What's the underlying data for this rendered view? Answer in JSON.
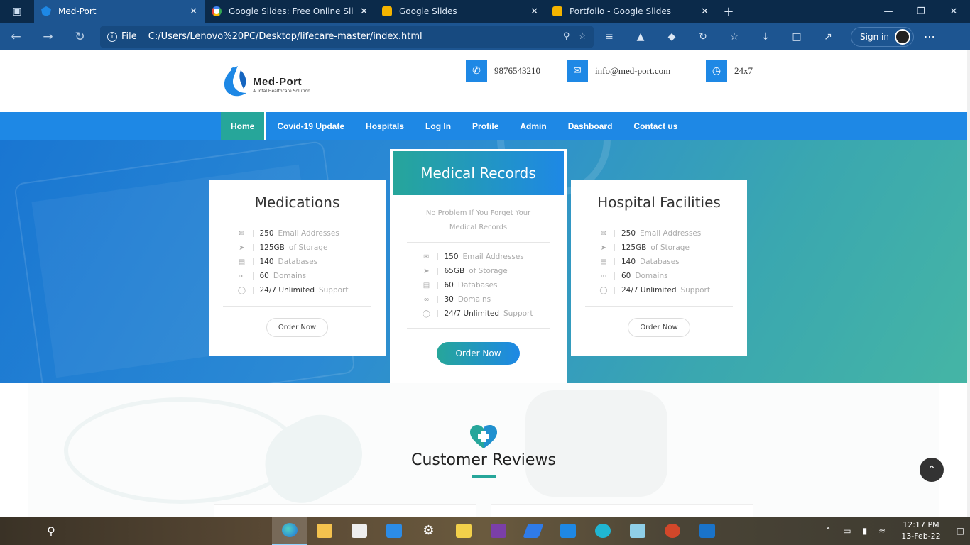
{
  "browser": {
    "tabs": [
      {
        "title": "Med-Port",
        "favicon": "med-port-favicon",
        "active": true
      },
      {
        "title": "Google Slides: Free Online Slide",
        "favicon": "google-favicon",
        "active": false
      },
      {
        "title": "Google Slides",
        "favicon": "slides-favicon",
        "active": false
      },
      {
        "title": "Portfolio - Google Slides",
        "favicon": "slides-favicon",
        "active": false
      }
    ],
    "address_scheme": "File",
    "address_url": "C:/Users/Lenovo%20PC/Desktop/lifecare-master/index.html",
    "sign_in": "Sign in"
  },
  "site": {
    "logo_name": "Med-Port",
    "logo_tagline": "A Total Healthcare Solution",
    "phone": "9876543210",
    "email": "info@med-port.com",
    "hours": "24x7",
    "accent": "#1e88e5",
    "accent2": "#26a69a"
  },
  "menu": [
    "Home",
    "Covid-19 Update",
    "Hospitals",
    "Log In",
    "Profile",
    "Admin",
    "Dashboard",
    "Contact us"
  ],
  "cards": {
    "left": {
      "title": "Medications",
      "features": [
        {
          "num": "250",
          "text": "Email Addresses"
        },
        {
          "num": "125GB",
          "text": "of Storage"
        },
        {
          "num": "140",
          "text": "Databases"
        },
        {
          "num": "60",
          "text": "Domains"
        },
        {
          "num": "24/7 Unlimited",
          "text": "Support"
        }
      ],
      "button": "Order Now"
    },
    "middle": {
      "title": "Medical Records",
      "subtitle_1": "No Problem If You Forget Your",
      "subtitle_2": "Medical Records",
      "features": [
        {
          "num": "150",
          "text": "Email Addresses"
        },
        {
          "num": "65GB",
          "text": "of Storage"
        },
        {
          "num": "60",
          "text": "Databases"
        },
        {
          "num": "30",
          "text": "Domains"
        },
        {
          "num": "24/7 Unlimited",
          "text": "Support"
        }
      ],
      "button": "Order Now"
    },
    "right": {
      "title": "Hospital Facilities",
      "features": [
        {
          "num": "250",
          "text": "Email Addresses"
        },
        {
          "num": "125GB",
          "text": "of Storage"
        },
        {
          "num": "140",
          "text": "Databases"
        },
        {
          "num": "60",
          "text": "Domains"
        },
        {
          "num": "24/7 Unlimited",
          "text": "Support"
        }
      ],
      "button": "Order Now"
    }
  },
  "reviews": {
    "title": "Customer Reviews"
  },
  "taskbar": {
    "time": "12:17 PM",
    "date": "13-Feb-22"
  }
}
